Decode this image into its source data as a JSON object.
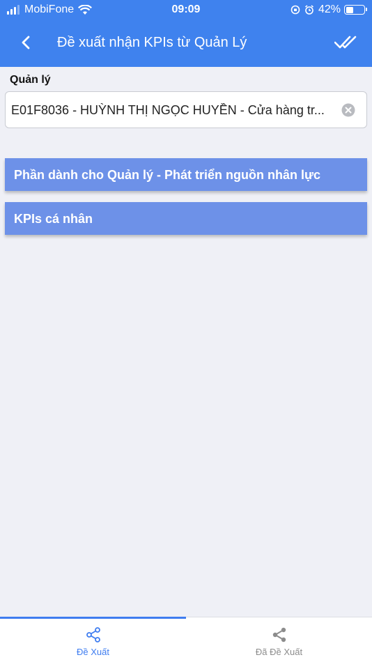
{
  "status_bar": {
    "carrier": "MobiFone",
    "time": "09:09",
    "battery": "42%",
    "battery_level": 0.42
  },
  "header": {
    "title": "Đề xuất nhận KPIs từ Quản Lý",
    "back_icon": "chevron-left-icon",
    "confirm_icon": "double-check-icon"
  },
  "form": {
    "manager_label": "Quản lý",
    "manager_value": "E01F8036 - HUỲNH THỊ NGỌC HUYỀN - Cửa hàng tr...",
    "clear_icon": "clear-circle-icon"
  },
  "sections": [
    {
      "label": "Phần dành cho Quản lý - Phát triển nguồn nhân lực"
    },
    {
      "label": "KPIs cá nhân"
    }
  ],
  "tabs": [
    {
      "label": "Đề Xuất",
      "icon": "share-icon",
      "active": true
    },
    {
      "label": "Đã Đề Xuất",
      "icon": "share-icon",
      "active": false
    }
  ],
  "colors": {
    "header": "#3f82ee",
    "section": "#6d91e8",
    "active_tab": "#3f7df0",
    "inactive_tab": "#8c8c8c",
    "background": "#eff0f6"
  }
}
